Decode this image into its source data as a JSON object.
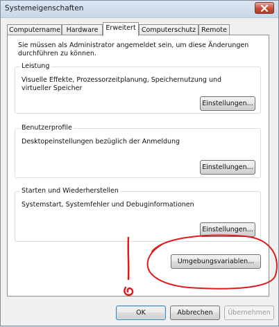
{
  "window": {
    "title": "Systemeigenschaften",
    "close_icon": "close-icon"
  },
  "tabs": [
    {
      "label": "Computername",
      "active": false
    },
    {
      "label": "Hardware",
      "active": false
    },
    {
      "label": "Erweitert",
      "active": true
    },
    {
      "label": "Computerschutz",
      "active": false
    },
    {
      "label": "Remote",
      "active": false
    }
  ],
  "notice": "Sie müssen als Administrator angemeldet sein, um diese Änderungen durchführen zu können.",
  "groups": {
    "performance": {
      "legend": "Leistung",
      "description": "Visuelle Effekte, Prozessorzeitplanung, Speichernutzung und virtueller Speicher",
      "button": "Einstellungen..."
    },
    "profiles": {
      "legend": "Benutzerprofile",
      "description": "Desktopeinstellungen bezüglich der Anmeldung",
      "button": "Einstellungen..."
    },
    "startup": {
      "legend": "Starten und Wiederherstellen",
      "description": "Systemstart, Systemfehler und Debuginformationen",
      "button": "Einstellungen..."
    }
  },
  "env_button": "Umgebungsvariablen...",
  "footer": {
    "ok": "OK",
    "cancel": "Abbrechen",
    "apply": "Übernehmen"
  },
  "annotation": {
    "color": "#e01a1a"
  }
}
